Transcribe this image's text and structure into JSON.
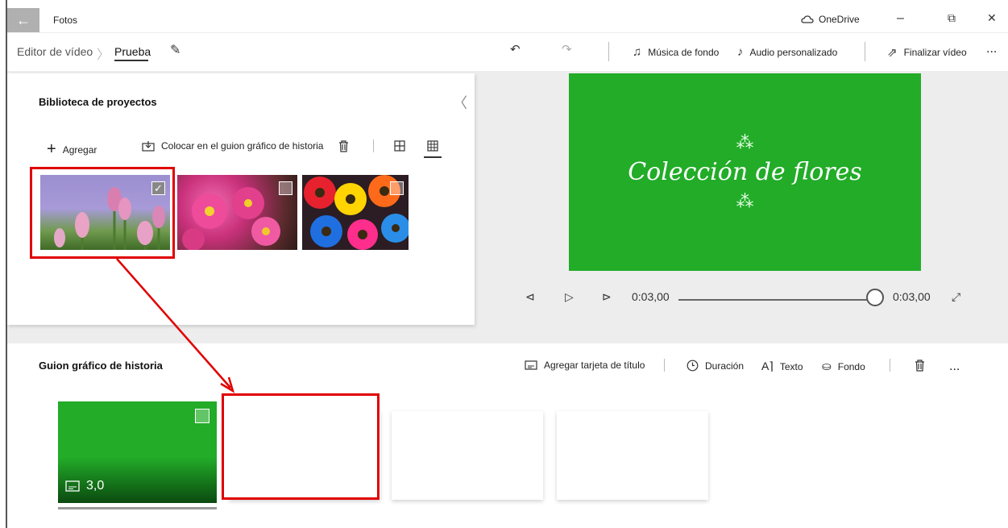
{
  "window": {
    "app_title": "Fotos",
    "back_icon": "arrow-left-icon",
    "onedrive_label": "OneDrive",
    "minimize": "–",
    "maximize": "⧉",
    "close": "✕"
  },
  "breadcrumb": {
    "root": "Editor de vídeo",
    "current": "Prueba"
  },
  "toolbar": {
    "undo_icon": "undo-icon",
    "redo_icon": "redo-icon",
    "music_label": "Música de fondo",
    "audio_label": "Audio personalizado",
    "finish_label": "Finalizar vídeo",
    "more": "..."
  },
  "library": {
    "title": "Biblioteca de proyectos",
    "add_label": "Agregar",
    "place_label": "Colocar en el guion gráfico de historia",
    "thumbnails": [
      {
        "name": "tulipanes",
        "selected": true
      },
      {
        "name": "flores-rosas",
        "selected": false
      },
      {
        "name": "margaritas-colores",
        "selected": false
      }
    ]
  },
  "preview": {
    "title": "Colección de flores",
    "time_current": "0:03,00",
    "time_total": "0:03,00",
    "accent": "#22ac28"
  },
  "storyboard": {
    "title": "Guion gráfico de historia",
    "add_title_card": "Agregar tarjeta de título",
    "duration": "Duración",
    "text": "Texto",
    "background": "Fondo",
    "more": "...",
    "first_card_duration": "3,0"
  },
  "colors": {
    "highlight": "#e00000",
    "green": "#22ac28"
  }
}
